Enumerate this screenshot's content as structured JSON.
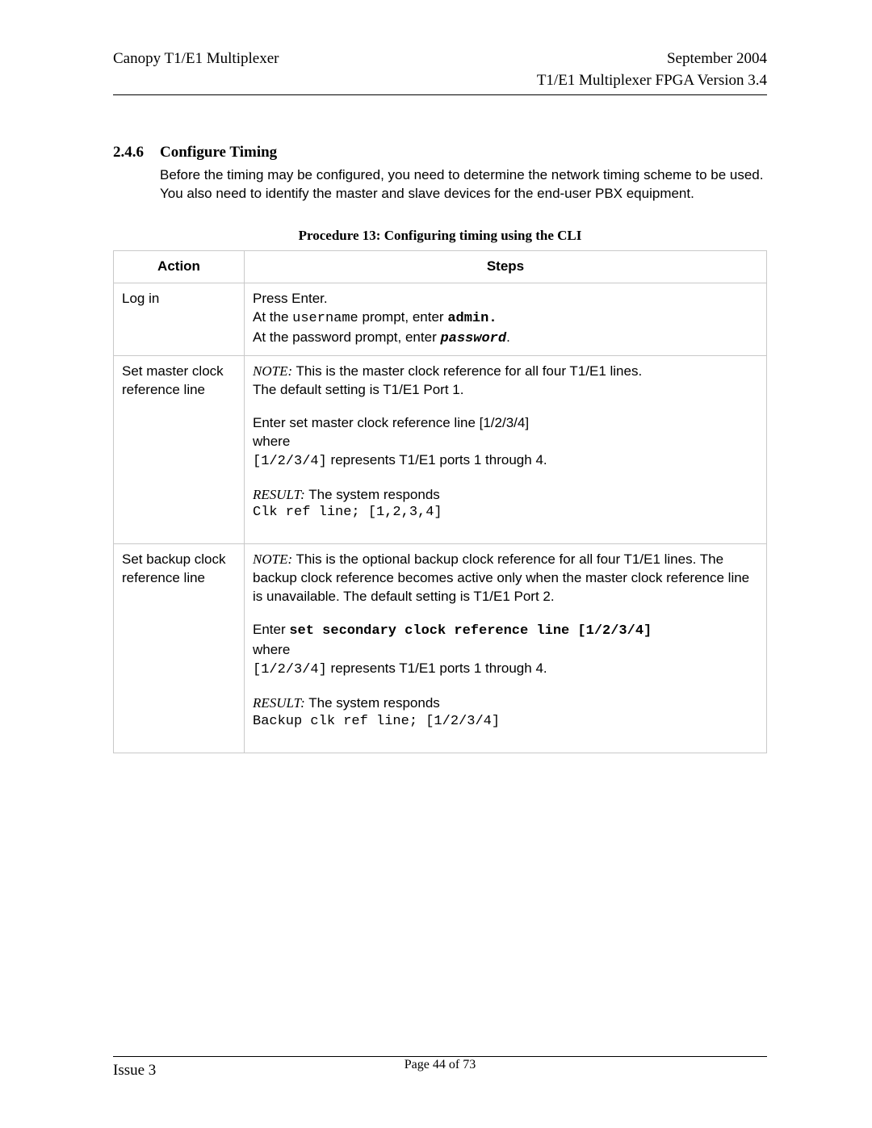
{
  "header": {
    "left": "Canopy T1/E1 Multiplexer",
    "right_line1": "September 2004",
    "right_line2": "T1/E1 Multiplexer FPGA Version 3.4"
  },
  "section": {
    "number": "2.4.6",
    "title": "Configure Timing",
    "body": "Before the timing may be configured, you need to determine the network timing scheme to be used.  You also need to identify the master and slave devices for the end-user PBX equipment."
  },
  "procedure_title": "Procedure 13: Configuring timing using the CLI",
  "table": {
    "head_action": "Action",
    "head_steps": "Steps",
    "rows": [
      {
        "action": "Log in",
        "steps": {
          "line1": "Press Enter.",
          "line2_a": "At the ",
          "line2_b": "username",
          "line2_c": " prompt, enter ",
          "line2_d": "admin.",
          "line3_a": "At the password prompt, enter ",
          "line3_b": "password",
          "line3_c": "."
        }
      },
      {
        "action": "Set master clock reference line",
        "steps": {
          "note_label": "NOTE:",
          "note_text": " This is the master clock reference for all four T1/E1 lines.",
          "default_line": "The default setting is T1/E1 Port 1.",
          "enter_line": "Enter set master clock reference line [1/2/3/4]",
          "where": "where",
          "ports_a": "[1/2/3/4]",
          "ports_b": " represents T1/E1 ports 1 through 4.",
          "result_label": "RESULT:",
          "result_text": " The system responds",
          "result_out": "Clk ref line; [1,2,3,4]"
        }
      },
      {
        "action": "Set backup clock reference line",
        "steps": {
          "note_label": "NOTE:",
          "note_text": " This is the optional backup clock reference for all four T1/E1 lines.  The backup clock reference becomes active only when the master clock reference line is unavailable. The default setting is T1/E1 Port 2.",
          "enter_a": "Enter ",
          "enter_b": "set secondary clock reference line [1/2/3/4]",
          "where": "where",
          "ports_a": "[1/2/3/4]",
          "ports_b": " represents T1/E1 ports 1 through 4.",
          "result_label": "RESULT:",
          "result_text": " The system responds",
          "result_out": "Backup clk ref line; [1/2/3/4]"
        }
      }
    ]
  },
  "footer": {
    "left": "Issue 3",
    "center_a": "Page ",
    "center_b": "44",
    "center_c": " of 73"
  }
}
